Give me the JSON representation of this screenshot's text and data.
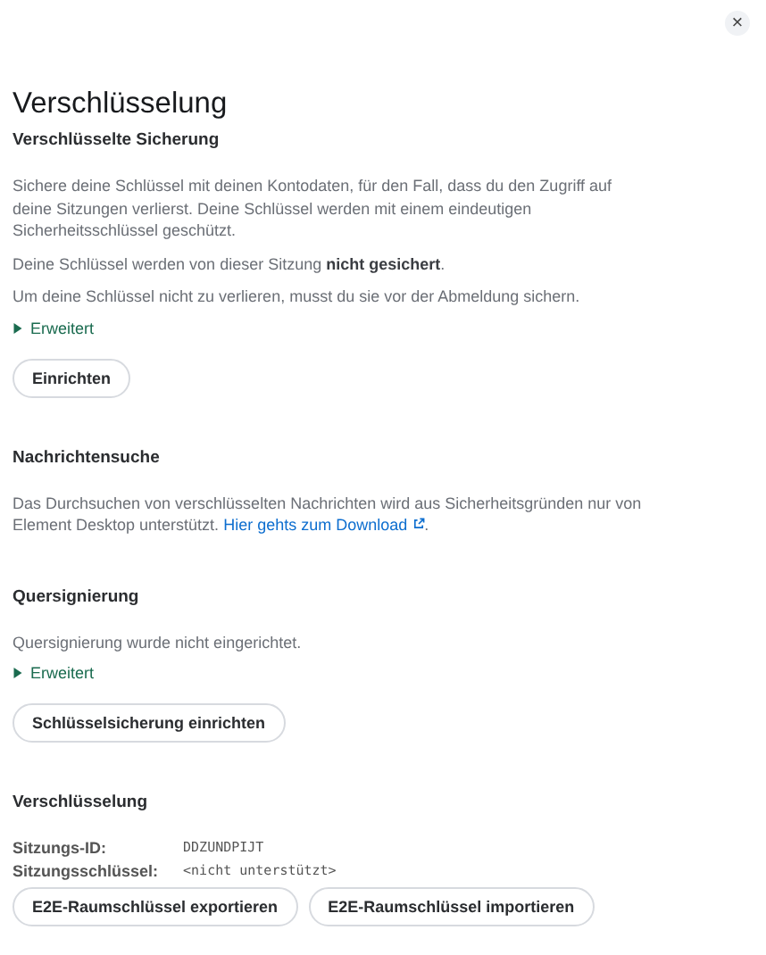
{
  "close_button": "×",
  "title": "Verschlüsselung",
  "sections": [
    {
      "heading": "Verschlüsselte Sicherung",
      "paragraphs": [
        {
          "text": "Sichere deine Schlüssel mit deinen Kontodaten, für den Fall, dass du den Zugriff auf deine Sitzungen verlierst. Deine Schlüssel werden mit einem eindeutigen Sicherheitsschlüssel geschützt."
        },
        {
          "text": "Deine Schlüssel werden von dieser Sitzung **nicht gesichert**."
        },
        {
          "text": "Um deine Schlüssel nicht zu verlieren, musst du sie vor der Abmeldung sichern."
        }
      ],
      "disclosure": {
        "label": "Erweitert",
        "expanded": false
      },
      "buttons": [
        "Einrichten"
      ]
    },
    {
      "heading": "Nachrichtensuche",
      "paragraphs": [
        {
          "text": "Das Durchsuchen von verschlüsselten Nachrichten wird aus Sicherheitsgründen nur von Element Desktop unterstützt.",
          "link": "Hier gehts zum Download",
          "after": "."
        }
      ]
    },
    {
      "heading": "Quersignierung",
      "paragraphs": [
        {
          "text": "Quersignierung wurde nicht eingerichtet."
        }
      ],
      "disclosure": {
        "label": "Erweitert",
        "expanded": false
      },
      "buttons": [
        "Schlüsselsicherung einrichten"
      ]
    },
    {
      "heading": "Verschlüsselung",
      "info": [
        {
          "label": "Sitzungs-ID:",
          "value": "DDZUNDPIJT"
        },
        {
          "label": "Sitzungsschlüssel:",
          "value": "<nicht unterstützt>"
        }
      ],
      "buttons": [
        "E2E-Raumschlüssel exportieren",
        "E2E-Raumschlüssel importieren"
      ]
    }
  ]
}
